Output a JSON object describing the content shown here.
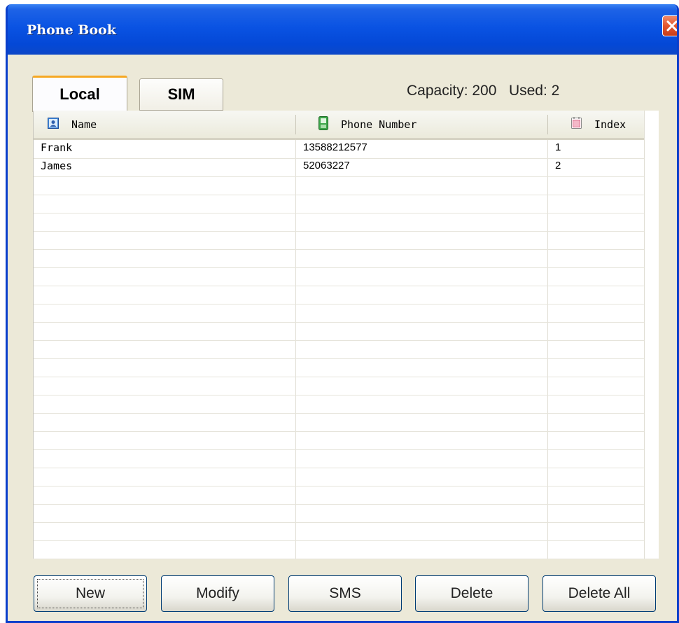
{
  "window": {
    "title": "Phone Book"
  },
  "tabs": [
    {
      "label": "Local",
      "active": true
    },
    {
      "label": "SIM",
      "active": false
    }
  ],
  "status": {
    "capacity_text": "Capacity: 200",
    "used_text": "Used: 2"
  },
  "table": {
    "columns": [
      {
        "label": "Name",
        "icon": "contact-card-icon"
      },
      {
        "label": "Phone Number",
        "icon": "mobile-phone-icon"
      },
      {
        "label": "Index",
        "icon": "calendar-icon"
      }
    ],
    "rows": [
      {
        "name": "Frank",
        "phone": "13588212577",
        "index": "1"
      },
      {
        "name": "James",
        "phone": "52063227",
        "index": "2"
      }
    ]
  },
  "buttons": {
    "new": "New",
    "modify": "Modify",
    "sms": "SMS",
    "delete": "Delete",
    "delete_all": "Delete All"
  },
  "colors": {
    "titlebar": "#0A53E3",
    "window_bg": "#ECE9D8",
    "active_tab_accent": "#F6A823",
    "close_button": "#E2562E"
  }
}
